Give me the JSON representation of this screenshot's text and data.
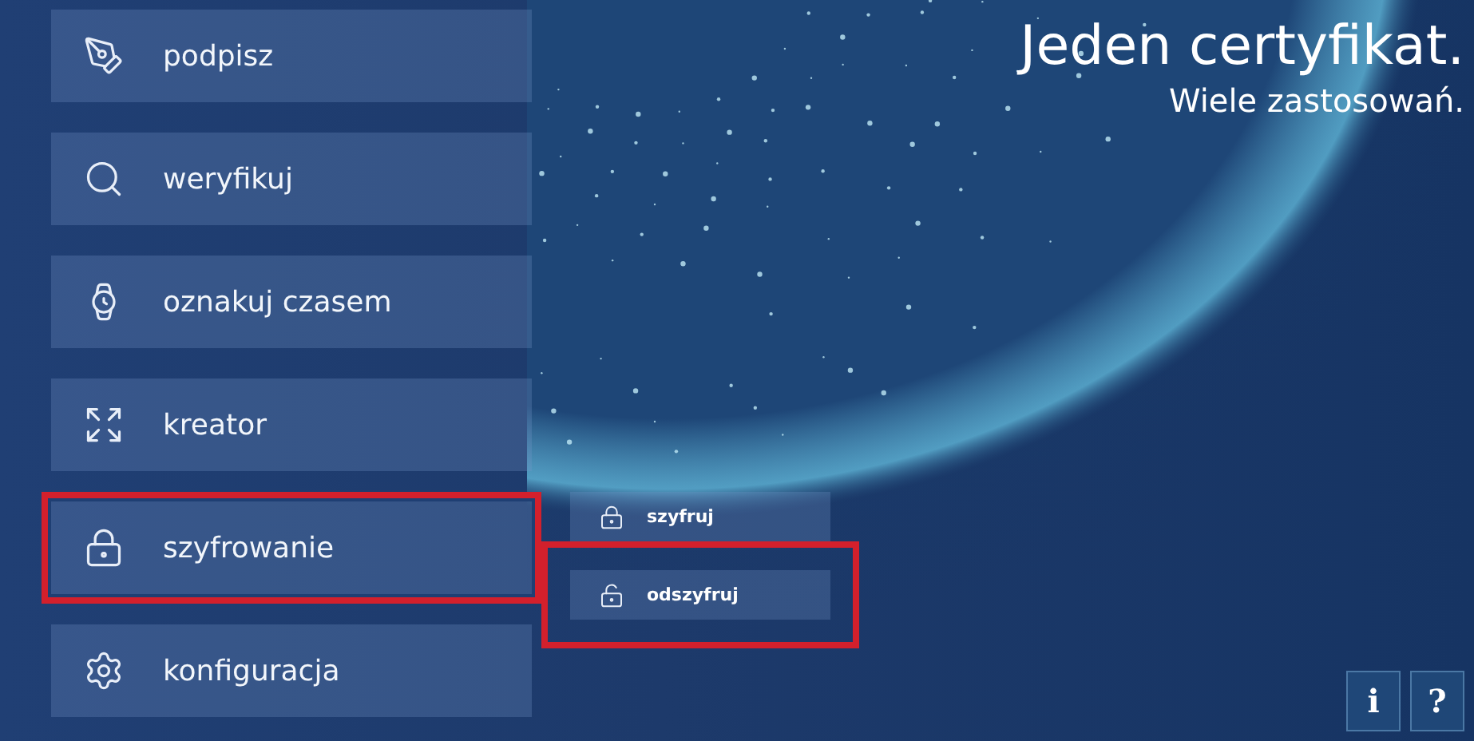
{
  "menu": {
    "items": [
      {
        "kind": "sign",
        "label": "podpisz",
        "highlighted": false
      },
      {
        "kind": "verify",
        "label": "weryfikuj",
        "highlighted": false
      },
      {
        "kind": "timestamp",
        "label": "oznakuj czasem",
        "highlighted": false
      },
      {
        "kind": "wizard",
        "label": "kreator",
        "highlighted": false
      },
      {
        "kind": "encryption",
        "label": "szyfrowanie",
        "highlighted": true
      },
      {
        "kind": "settings",
        "label": "konfiguracja",
        "highlighted": false
      }
    ]
  },
  "submenu": {
    "items": [
      {
        "kind": "lock",
        "label": "szyfruj",
        "highlighted": false
      },
      {
        "kind": "unlock",
        "label": "odszyfruj",
        "highlighted": true
      }
    ]
  },
  "headline": {
    "title": "Jeden certyfikat.",
    "subtitle": "Wiele zastosowań."
  },
  "help_buttons": [
    "i",
    "?"
  ]
}
